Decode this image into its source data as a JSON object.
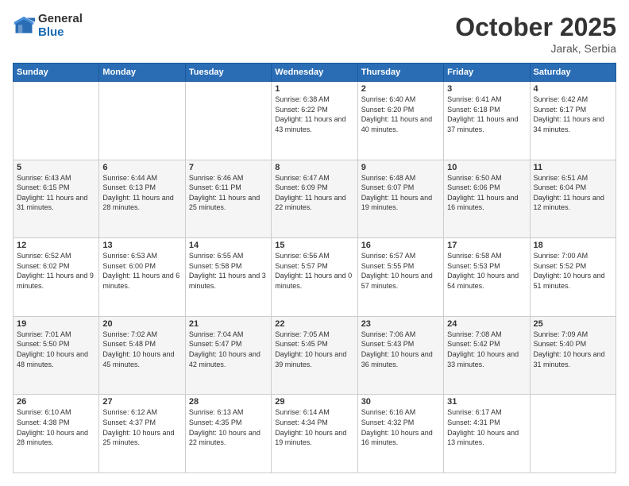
{
  "header": {
    "logo_general": "General",
    "logo_blue": "Blue",
    "month": "October 2025",
    "location": "Jarak, Serbia"
  },
  "weekdays": [
    "Sunday",
    "Monday",
    "Tuesday",
    "Wednesday",
    "Thursday",
    "Friday",
    "Saturday"
  ],
  "weeks": [
    [
      {
        "day": "",
        "sunrise": "",
        "sunset": "",
        "daylight": ""
      },
      {
        "day": "",
        "sunrise": "",
        "sunset": "",
        "daylight": ""
      },
      {
        "day": "",
        "sunrise": "",
        "sunset": "",
        "daylight": ""
      },
      {
        "day": "1",
        "sunrise": "Sunrise: 6:38 AM",
        "sunset": "Sunset: 6:22 PM",
        "daylight": "Daylight: 11 hours and 43 minutes."
      },
      {
        "day": "2",
        "sunrise": "Sunrise: 6:40 AM",
        "sunset": "Sunset: 6:20 PM",
        "daylight": "Daylight: 11 hours and 40 minutes."
      },
      {
        "day": "3",
        "sunrise": "Sunrise: 6:41 AM",
        "sunset": "Sunset: 6:18 PM",
        "daylight": "Daylight: 11 hours and 37 minutes."
      },
      {
        "day": "4",
        "sunrise": "Sunrise: 6:42 AM",
        "sunset": "Sunset: 6:17 PM",
        "daylight": "Daylight: 11 hours and 34 minutes."
      }
    ],
    [
      {
        "day": "5",
        "sunrise": "Sunrise: 6:43 AM",
        "sunset": "Sunset: 6:15 PM",
        "daylight": "Daylight: 11 hours and 31 minutes."
      },
      {
        "day": "6",
        "sunrise": "Sunrise: 6:44 AM",
        "sunset": "Sunset: 6:13 PM",
        "daylight": "Daylight: 11 hours and 28 minutes."
      },
      {
        "day": "7",
        "sunrise": "Sunrise: 6:46 AM",
        "sunset": "Sunset: 6:11 PM",
        "daylight": "Daylight: 11 hours and 25 minutes."
      },
      {
        "day": "8",
        "sunrise": "Sunrise: 6:47 AM",
        "sunset": "Sunset: 6:09 PM",
        "daylight": "Daylight: 11 hours and 22 minutes."
      },
      {
        "day": "9",
        "sunrise": "Sunrise: 6:48 AM",
        "sunset": "Sunset: 6:07 PM",
        "daylight": "Daylight: 11 hours and 19 minutes."
      },
      {
        "day": "10",
        "sunrise": "Sunrise: 6:50 AM",
        "sunset": "Sunset: 6:06 PM",
        "daylight": "Daylight: 11 hours and 16 minutes."
      },
      {
        "day": "11",
        "sunrise": "Sunrise: 6:51 AM",
        "sunset": "Sunset: 6:04 PM",
        "daylight": "Daylight: 11 hours and 12 minutes."
      }
    ],
    [
      {
        "day": "12",
        "sunrise": "Sunrise: 6:52 AM",
        "sunset": "Sunset: 6:02 PM",
        "daylight": "Daylight: 11 hours and 9 minutes."
      },
      {
        "day": "13",
        "sunrise": "Sunrise: 6:53 AM",
        "sunset": "Sunset: 6:00 PM",
        "daylight": "Daylight: 11 hours and 6 minutes."
      },
      {
        "day": "14",
        "sunrise": "Sunrise: 6:55 AM",
        "sunset": "Sunset: 5:58 PM",
        "daylight": "Daylight: 11 hours and 3 minutes."
      },
      {
        "day": "15",
        "sunrise": "Sunrise: 6:56 AM",
        "sunset": "Sunset: 5:57 PM",
        "daylight": "Daylight: 11 hours and 0 minutes."
      },
      {
        "day": "16",
        "sunrise": "Sunrise: 6:57 AM",
        "sunset": "Sunset: 5:55 PM",
        "daylight": "Daylight: 10 hours and 57 minutes."
      },
      {
        "day": "17",
        "sunrise": "Sunrise: 6:58 AM",
        "sunset": "Sunset: 5:53 PM",
        "daylight": "Daylight: 10 hours and 54 minutes."
      },
      {
        "day": "18",
        "sunrise": "Sunrise: 7:00 AM",
        "sunset": "Sunset: 5:52 PM",
        "daylight": "Daylight: 10 hours and 51 minutes."
      }
    ],
    [
      {
        "day": "19",
        "sunrise": "Sunrise: 7:01 AM",
        "sunset": "Sunset: 5:50 PM",
        "daylight": "Daylight: 10 hours and 48 minutes."
      },
      {
        "day": "20",
        "sunrise": "Sunrise: 7:02 AM",
        "sunset": "Sunset: 5:48 PM",
        "daylight": "Daylight: 10 hours and 45 minutes."
      },
      {
        "day": "21",
        "sunrise": "Sunrise: 7:04 AM",
        "sunset": "Sunset: 5:47 PM",
        "daylight": "Daylight: 10 hours and 42 minutes."
      },
      {
        "day": "22",
        "sunrise": "Sunrise: 7:05 AM",
        "sunset": "Sunset: 5:45 PM",
        "daylight": "Daylight: 10 hours and 39 minutes."
      },
      {
        "day": "23",
        "sunrise": "Sunrise: 7:06 AM",
        "sunset": "Sunset: 5:43 PM",
        "daylight": "Daylight: 10 hours and 36 minutes."
      },
      {
        "day": "24",
        "sunrise": "Sunrise: 7:08 AM",
        "sunset": "Sunset: 5:42 PM",
        "daylight": "Daylight: 10 hours and 33 minutes."
      },
      {
        "day": "25",
        "sunrise": "Sunrise: 7:09 AM",
        "sunset": "Sunset: 5:40 PM",
        "daylight": "Daylight: 10 hours and 31 minutes."
      }
    ],
    [
      {
        "day": "26",
        "sunrise": "Sunrise: 6:10 AM",
        "sunset": "Sunset: 4:38 PM",
        "daylight": "Daylight: 10 hours and 28 minutes."
      },
      {
        "day": "27",
        "sunrise": "Sunrise: 6:12 AM",
        "sunset": "Sunset: 4:37 PM",
        "daylight": "Daylight: 10 hours and 25 minutes."
      },
      {
        "day": "28",
        "sunrise": "Sunrise: 6:13 AM",
        "sunset": "Sunset: 4:35 PM",
        "daylight": "Daylight: 10 hours and 22 minutes."
      },
      {
        "day": "29",
        "sunrise": "Sunrise: 6:14 AM",
        "sunset": "Sunset: 4:34 PM",
        "daylight": "Daylight: 10 hours and 19 minutes."
      },
      {
        "day": "30",
        "sunrise": "Sunrise: 6:16 AM",
        "sunset": "Sunset: 4:32 PM",
        "daylight": "Daylight: 10 hours and 16 minutes."
      },
      {
        "day": "31",
        "sunrise": "Sunrise: 6:17 AM",
        "sunset": "Sunset: 4:31 PM",
        "daylight": "Daylight: 10 hours and 13 minutes."
      },
      {
        "day": "",
        "sunrise": "",
        "sunset": "",
        "daylight": ""
      }
    ]
  ]
}
